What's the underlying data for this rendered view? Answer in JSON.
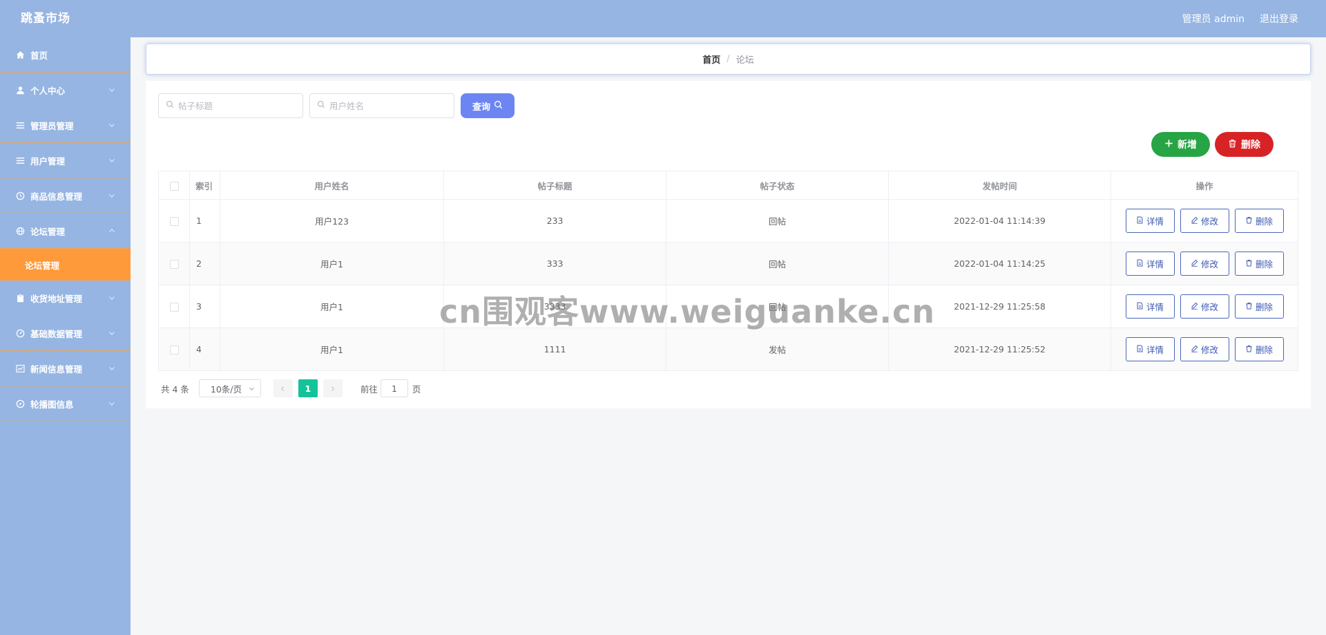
{
  "header": {
    "brand": "跳蚤市场",
    "admin_label": "管理员 admin",
    "logout_label": "退出登录"
  },
  "sidebar": {
    "items": [
      {
        "label": "首页",
        "icon": "home-icon",
        "has_arrow": false
      },
      {
        "label": "个人中心",
        "icon": "user-icon",
        "has_arrow": true
      },
      {
        "label": "管理员管理",
        "icon": "menu-icon",
        "has_arrow": true
      },
      {
        "label": "用户管理",
        "icon": "menu-icon",
        "has_arrow": true
      },
      {
        "label": "商品信息管理",
        "icon": "clock-icon",
        "has_arrow": true
      },
      {
        "label": "论坛管理",
        "icon": "globe-icon",
        "has_arrow": true,
        "expanded": true
      },
      {
        "label": "收货地址管理",
        "icon": "clipboard-icon",
        "has_arrow": true
      },
      {
        "label": "基础数据管理",
        "icon": "gauge-icon",
        "has_arrow": true
      },
      {
        "label": "新闻信息管理",
        "icon": "chart-icon",
        "has_arrow": true
      },
      {
        "label": "轮播图信息",
        "icon": "compass-icon",
        "has_arrow": true
      }
    ],
    "sub_item": {
      "label": "论坛管理",
      "active_color": "#ff9a3a"
    }
  },
  "breadcrumb": {
    "home": "首页",
    "separator": "/",
    "current": "论坛"
  },
  "search": {
    "title_placeholder": "帖子标题",
    "user_placeholder": "用户姓名",
    "query_label": "查询"
  },
  "actions": {
    "add_label": "新增",
    "delete_label": "删除"
  },
  "table": {
    "headers": {
      "index": "索引",
      "user": "用户姓名",
      "title": "帖子标题",
      "status": "帖子状态",
      "time": "发帖时间",
      "ops": "操作"
    },
    "rows": [
      {
        "index": "1",
        "user": "用户123",
        "title": "233",
        "status": "回帖",
        "time": "2022-01-04 11:14:39"
      },
      {
        "index": "2",
        "user": "用户1",
        "title": "333",
        "status": "回帖",
        "time": "2022-01-04 11:14:25"
      },
      {
        "index": "3",
        "user": "用户1",
        "title": "3333",
        "status": "回帖",
        "time": "2021-12-29 11:25:58"
      },
      {
        "index": "4",
        "user": "用户1",
        "title": "1111",
        "status": "发帖",
        "time": "2021-12-29 11:25:52"
      }
    ],
    "op_labels": {
      "detail": "详情",
      "edit": "修改",
      "delete": "删除"
    }
  },
  "pagination": {
    "total": "共 4 条",
    "page_size": "10条/页",
    "current_page": "1",
    "goto_prefix": "前往",
    "goto_value": "1",
    "goto_suffix": "页"
  },
  "watermark": "cn围观客www.weiguanke.cn",
  "colors": {
    "header_bg": "#96b5e2",
    "sidebar_active": "#ff9a3a",
    "query_button": "#6c85f2",
    "add_button": "#27a444",
    "delete_button": "#d72325",
    "page_active": "#14c39a"
  }
}
